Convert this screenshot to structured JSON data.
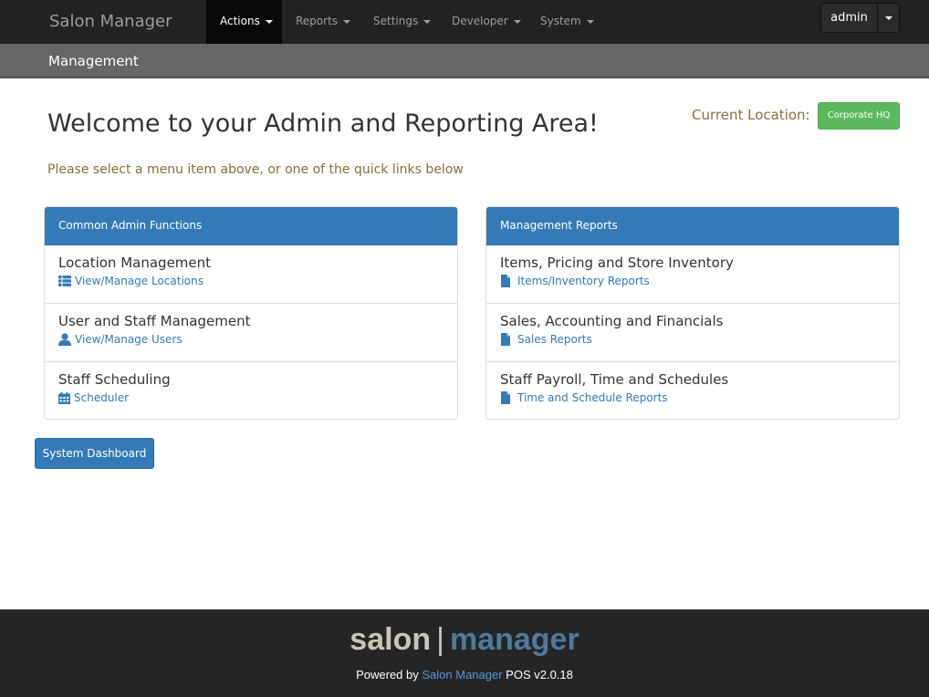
{
  "navbar": {
    "brand": "Salon Manager",
    "menu": [
      {
        "label": "Actions",
        "active": true
      },
      {
        "label": "Reports",
        "active": false
      },
      {
        "label": "Settings",
        "active": false
      },
      {
        "label": "Developer",
        "active": false
      },
      {
        "label": "System",
        "active": false
      }
    ],
    "user": "admin"
  },
  "subheader": {
    "title": "Management"
  },
  "main": {
    "welcome": "Welcome to your Admin and Reporting Area!",
    "location_label": "Current Location:",
    "location_value": "Corporate HQ",
    "lead": "Please select a menu item above, or one of the quick links below"
  },
  "panels": [
    {
      "heading": "Common Admin Functions",
      "rows": [
        {
          "title": "Location Management",
          "link": "View/Manage Locations",
          "icon": "list-icon"
        },
        {
          "title": "User and Staff Management",
          "link": "View/Manage Users",
          "icon": "user-icon"
        },
        {
          "title": "Staff Scheduling",
          "link": "Scheduler",
          "icon": "calendar-icon"
        }
      ]
    },
    {
      "heading": "Management Reports",
      "rows": [
        {
          "title": "Items, Pricing and Store Inventory",
          "link": "Items/Inventory Reports",
          "icon": "file-icon"
        },
        {
          "title": "Sales, Accounting and Financials",
          "link": "Sales Reports",
          "icon": "file-icon"
        },
        {
          "title": "Staff Payroll, Time and Schedules",
          "link": "Time and Schedule Reports",
          "icon": "file-icon"
        }
      ]
    }
  ],
  "dashboard_button": "System Dashboard",
  "footer": {
    "logo_left": "salon",
    "logo_sep": "|",
    "logo_right": "manager",
    "powered_prefix": "Powered by",
    "powered_link": "Salon Manager",
    "powered_suffix": "POS v2.0.18"
  },
  "colors": {
    "navbar_bg": "#222222",
    "primary": "#337ab7",
    "success": "#5cb85c",
    "warning_text": "#8a6d3b"
  }
}
